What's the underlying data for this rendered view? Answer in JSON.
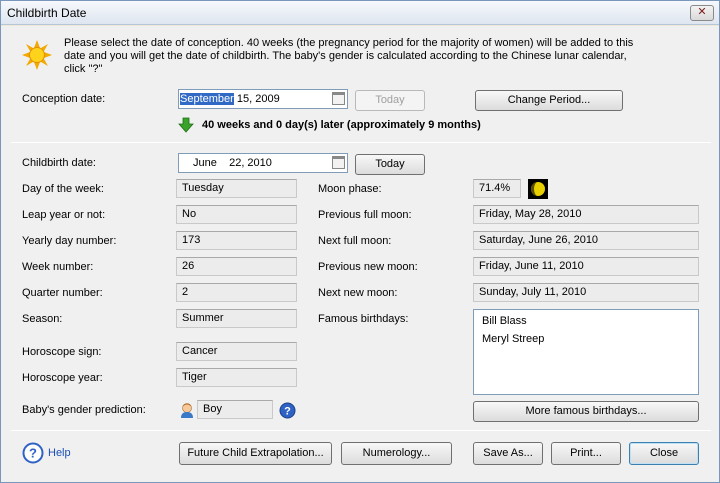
{
  "window": {
    "title": "Childbirth Date",
    "close_glyph": "✕"
  },
  "intro": {
    "line1": "Please select the date of conception. 40 weeks (the pregnancy period for the majority of women) will be added to this",
    "line2": "date and you will get the date of childbirth. The baby's gender is calculated according to the Chinese lunar calendar,",
    "line3": "click \"?\""
  },
  "conception": {
    "label": "Conception date:",
    "month": "September",
    "rest": " 15, 2009",
    "today_label": "Today",
    "change_period_label": "Change Period..."
  },
  "result_text": "40 weeks and 0 day(s) later (approximately 9 months)",
  "childbirth": {
    "label": "Childbirth date:",
    "value": "June    22, 2010",
    "today_label": "Today"
  },
  "left_fields": [
    {
      "label": "Day of the week:",
      "value": "Tuesday"
    },
    {
      "label": "Leap year or not:",
      "value": "No"
    },
    {
      "label": "Yearly day number:",
      "value": "173"
    },
    {
      "label": "Week number:",
      "value": "26"
    },
    {
      "label": "Quarter number:",
      "value": "2"
    },
    {
      "label": "Season:",
      "value": "Summer"
    },
    {
      "label": "Horoscope sign:",
      "value": "Cancer"
    },
    {
      "label": "Horoscope year:",
      "value": "Tiger"
    }
  ],
  "gender": {
    "label": "Baby's gender prediction:",
    "value": "Boy",
    "help_glyph": "?"
  },
  "moon": {
    "label": "Moon phase:",
    "value": "71.4%"
  },
  "right_fields": [
    {
      "label": "Previous full moon:",
      "value": "Friday, May 28, 2010"
    },
    {
      "label": "Next full moon:",
      "value": "Saturday, June 26, 2010"
    },
    {
      "label": "Previous new moon:",
      "value": "Friday, June 11, 2010"
    },
    {
      "label": "Next new moon:",
      "value": "Sunday, July 11, 2010"
    }
  ],
  "famous": {
    "label": "Famous birthdays:",
    "items": [
      "Bill Blass",
      "Meryl Streep"
    ],
    "more_label": "More famous birthdays..."
  },
  "footer": {
    "help_label": "Help",
    "help_glyph": "?",
    "future_label": "Future Child Extrapolation...",
    "numerology_label": "Numerology...",
    "saveas_label": "Save As...",
    "print_label": "Print...",
    "close_label": "Close"
  },
  "icons": {
    "intro": "sun-icon",
    "result": "green-down-arrow-icon",
    "moon": "moon-phase-icon",
    "gender": "boy-icon",
    "help": "question-circle-icon"
  },
  "colors": {
    "accent": "#316ac5",
    "arrow": "#3aa32a",
    "moon": "#e8d000",
    "help": "#2e62c5"
  }
}
